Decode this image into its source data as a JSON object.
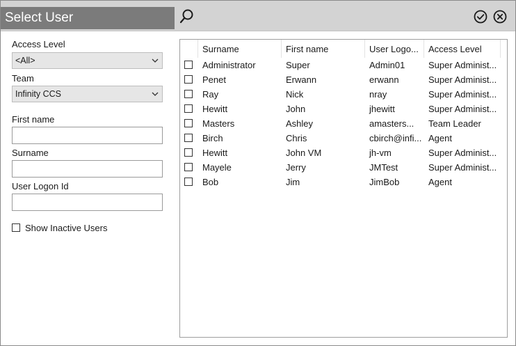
{
  "window": {
    "title": "Select User"
  },
  "filters": {
    "access_level_label": "Access Level",
    "access_level_value": "<All>",
    "team_label": "Team",
    "team_value": "Infinity CCS",
    "first_name_label": "First name",
    "first_name_value": "",
    "surname_label": "Surname",
    "surname_value": "",
    "logon_label": "User Logon Id",
    "logon_value": "",
    "show_inactive_label": "Show Inactive Users",
    "show_inactive_checked": false
  },
  "grid": {
    "columns": [
      "Surname",
      "First name",
      "User Logo...",
      "Access Level"
    ],
    "rows": [
      [
        "Administrator",
        "Super",
        "Admin01",
        "Super Administ..."
      ],
      [
        "Penet",
        "Erwann",
        "erwann",
        "Super Administ..."
      ],
      [
        "Ray",
        "Nick",
        "nray",
        "Super Administ..."
      ],
      [
        "Hewitt",
        "John",
        "jhewitt",
        "Super Administ..."
      ],
      [
        "Masters",
        "Ashley",
        "amasters...",
        "Team Leader"
      ],
      [
        "Birch",
        "Chris",
        "cbirch@infi...",
        "Agent"
      ],
      [
        "Hewitt",
        "John VM",
        "jh-vm",
        "Super Administ..."
      ],
      [
        "Mayele",
        "Jerry",
        "JMTest",
        "Super Administ..."
      ],
      [
        "Bob",
        "Jim",
        "JimBob",
        "Agent"
      ]
    ]
  },
  "icons": {
    "search": "search-icon",
    "ok": "check-circle-icon",
    "close": "close-circle-icon"
  }
}
